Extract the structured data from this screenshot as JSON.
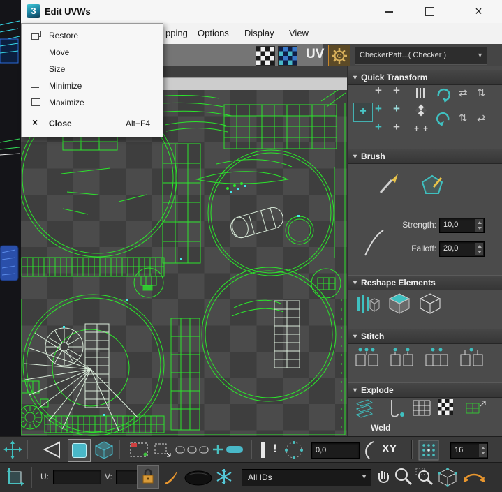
{
  "window": {
    "title": "Edit UVWs",
    "logo_text": "3"
  },
  "context_menu": {
    "items": [
      {
        "label": "Restore",
        "shortcut": ""
      },
      {
        "label": "Move",
        "shortcut": ""
      },
      {
        "label": "Size",
        "shortcut": ""
      },
      {
        "label": "Minimize",
        "shortcut": ""
      },
      {
        "label": "Maximize",
        "shortcut": ""
      },
      {
        "label": "Close",
        "shortcut": "Alt+F4"
      }
    ]
  },
  "menubar": {
    "items": [
      {
        "label": "pping"
      },
      {
        "label": "Options"
      },
      {
        "label": "Display"
      },
      {
        "label": "View"
      }
    ]
  },
  "toolbar": {
    "uv_label": "UV",
    "texture_dropdown_value": "CheckerPatt...( Checker )"
  },
  "rollouts": {
    "quick_transform": "Quick Transform",
    "brush": "Brush",
    "reshape_elements": "Reshape Elements",
    "stitch": "Stitch",
    "explode": "Explode",
    "weld": "Weld"
  },
  "brush_panel": {
    "strength_label": "Strength:",
    "strength_value": "10,0",
    "falloff_label": "Falloff:",
    "falloff_value": "20,0"
  },
  "transform_row": {
    "value": "0,0",
    "axis_label": "XY",
    "grid_size": "16",
    "exclaim": "!"
  },
  "status_row": {
    "u_label": "U:",
    "v_label": "V:",
    "id_filter": "All IDs"
  },
  "icons": {
    "plus": "+",
    "swap_h": "⇄",
    "swap_v": "⇅",
    "rollout_arrow": "▾",
    "dropdown_arrow": "▼",
    "close_glyph": "×"
  },
  "colors": {
    "accent_teal": "#49b8c8",
    "wire_green": "#2ce52c",
    "accent_orange": "#e8962e"
  }
}
